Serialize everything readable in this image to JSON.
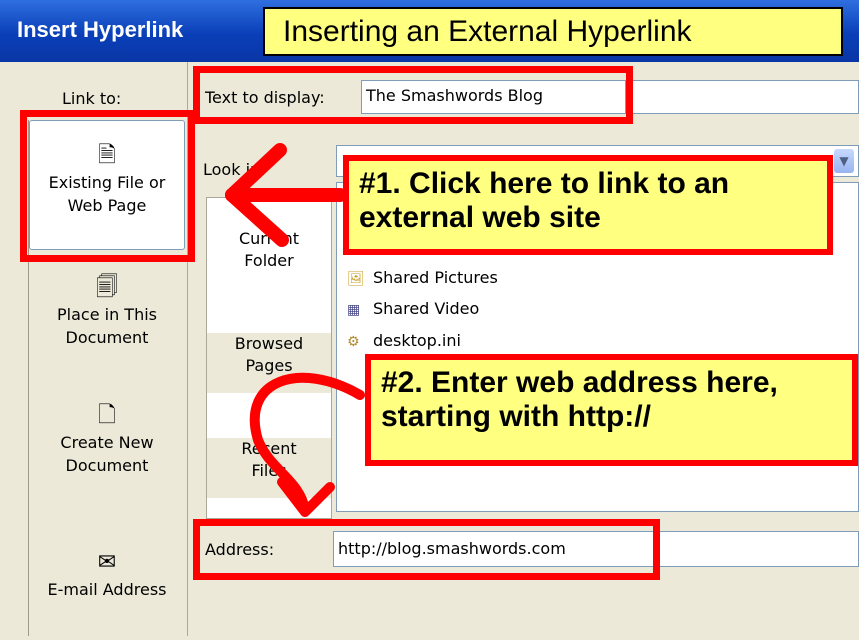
{
  "title": "Insert Hyperlink",
  "banner": "Inserting an External Hyperlink",
  "link_to_label": "Link to:",
  "left_nav": [
    {
      "label": "Existing File or Web Page",
      "icon": "globe-doc-icon"
    },
    {
      "label": "Place in This Document",
      "icon": "place-doc-icon"
    },
    {
      "label": "Create New Document",
      "icon": "new-doc-icon"
    },
    {
      "label": "E-mail Address",
      "icon": "email-icon"
    }
  ],
  "text_to_display": {
    "label": "Text to display:",
    "value": "The Smashwords Blog"
  },
  "look_in_label": "Look in:",
  "nav_panel": [
    {
      "label": "Current Folder"
    },
    {
      "label": "Browsed Pages"
    },
    {
      "label": "Recent Files"
    }
  ],
  "files": [
    {
      "name": "Shared Pictures",
      "icon": "folder-pictures-icon"
    },
    {
      "name": "Shared Video",
      "icon": "folder-video-icon"
    },
    {
      "name": "desktop.ini",
      "icon": "ini-file-icon"
    }
  ],
  "address": {
    "label": "Address:",
    "value": "http://blog.smashwords.com"
  },
  "annotations": [
    "#1.  Click here to link to an external web site",
    "#2.  Enter web address here, starting with http://"
  ],
  "colors": {
    "accent_red": "#ff0000",
    "note_yellow": "#FFFF80",
    "title_blue": "#0a3fb8"
  }
}
